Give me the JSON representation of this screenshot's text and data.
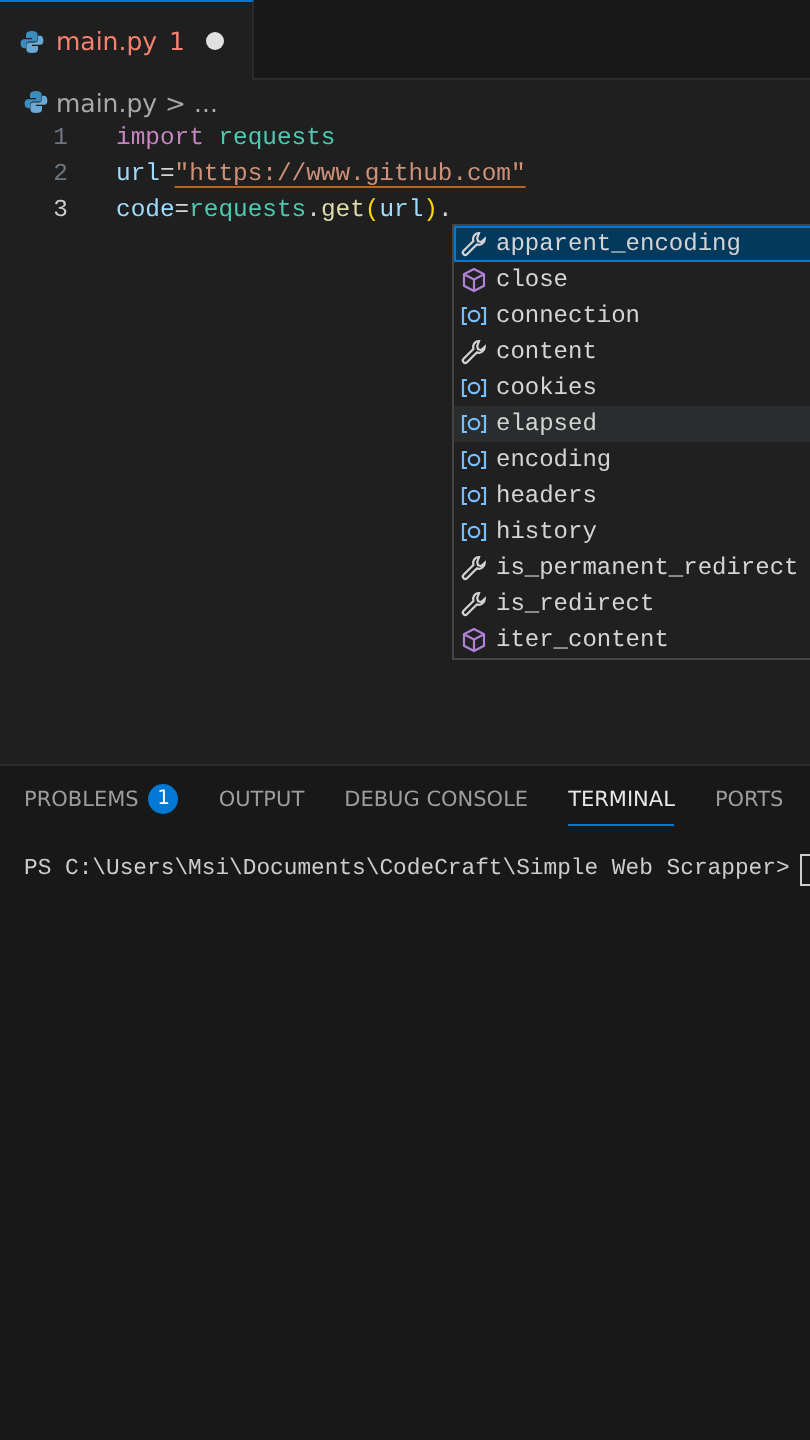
{
  "tabs": [
    {
      "label": "main.py",
      "problems": "1",
      "modified": true,
      "selected": true
    }
  ],
  "breadcrumb": {
    "file": "main.py",
    "separator": ">",
    "rest": "..."
  },
  "code_lines": [
    {
      "number": "1",
      "current": false,
      "tokens": [
        {
          "kind": "keyword",
          "text": "import"
        },
        {
          "kind": "module",
          "text": " requests"
        }
      ]
    },
    {
      "number": "2",
      "current": false,
      "tokens": [
        {
          "kind": "variable",
          "text": "url"
        },
        {
          "kind": "plain",
          "text": "="
        },
        {
          "kind": "string",
          "text": "\"https://www.github.com\""
        }
      ]
    },
    {
      "number": "3",
      "current": true,
      "tokens": [
        {
          "kind": "variable",
          "text": "code"
        },
        {
          "kind": "plain",
          "text": "="
        },
        {
          "kind": "module",
          "text": "requests"
        },
        {
          "kind": "plain",
          "text": "."
        },
        {
          "kind": "function",
          "text": "get"
        },
        {
          "kind": "paren",
          "text": "("
        },
        {
          "kind": "variable",
          "text": "url"
        },
        {
          "kind": "paren",
          "text": ")"
        },
        {
          "kind": "plain",
          "text": "."
        }
      ]
    }
  ],
  "suggestions": [
    {
      "kind": "property",
      "label": "apparent_encoding",
      "selected": true,
      "hovered": false
    },
    {
      "kind": "method",
      "label": "close",
      "selected": false,
      "hovered": false
    },
    {
      "kind": "field",
      "label": "connection",
      "selected": false,
      "hovered": false
    },
    {
      "kind": "property",
      "label": "content",
      "selected": false,
      "hovered": false
    },
    {
      "kind": "field",
      "label": "cookies",
      "selected": false,
      "hovered": false
    },
    {
      "kind": "field",
      "label": "elapsed",
      "selected": false,
      "hovered": true
    },
    {
      "kind": "field",
      "label": "encoding",
      "selected": false,
      "hovered": false
    },
    {
      "kind": "field",
      "label": "headers",
      "selected": false,
      "hovered": false
    },
    {
      "kind": "field",
      "label": "history",
      "selected": false,
      "hovered": false
    },
    {
      "kind": "property",
      "label": "is_permanent_redirect",
      "selected": false,
      "hovered": false
    },
    {
      "kind": "property",
      "label": "is_redirect",
      "selected": false,
      "hovered": false
    },
    {
      "kind": "method",
      "label": "iter_content",
      "selected": false,
      "hovered": false
    }
  ],
  "panel_tabs": [
    {
      "label": "PROBLEMS",
      "badge": "1",
      "selected": false
    },
    {
      "label": "OUTPUT",
      "selected": false
    },
    {
      "label": "DEBUG CONSOLE",
      "selected": false
    },
    {
      "label": "TERMINAL",
      "selected": true
    },
    {
      "label": "PORTS",
      "selected": false
    }
  ],
  "terminal": {
    "prompt": "PS C:\\Users\\Msi\\Documents\\CodeCraft\\Simple Web Scrapper>"
  }
}
